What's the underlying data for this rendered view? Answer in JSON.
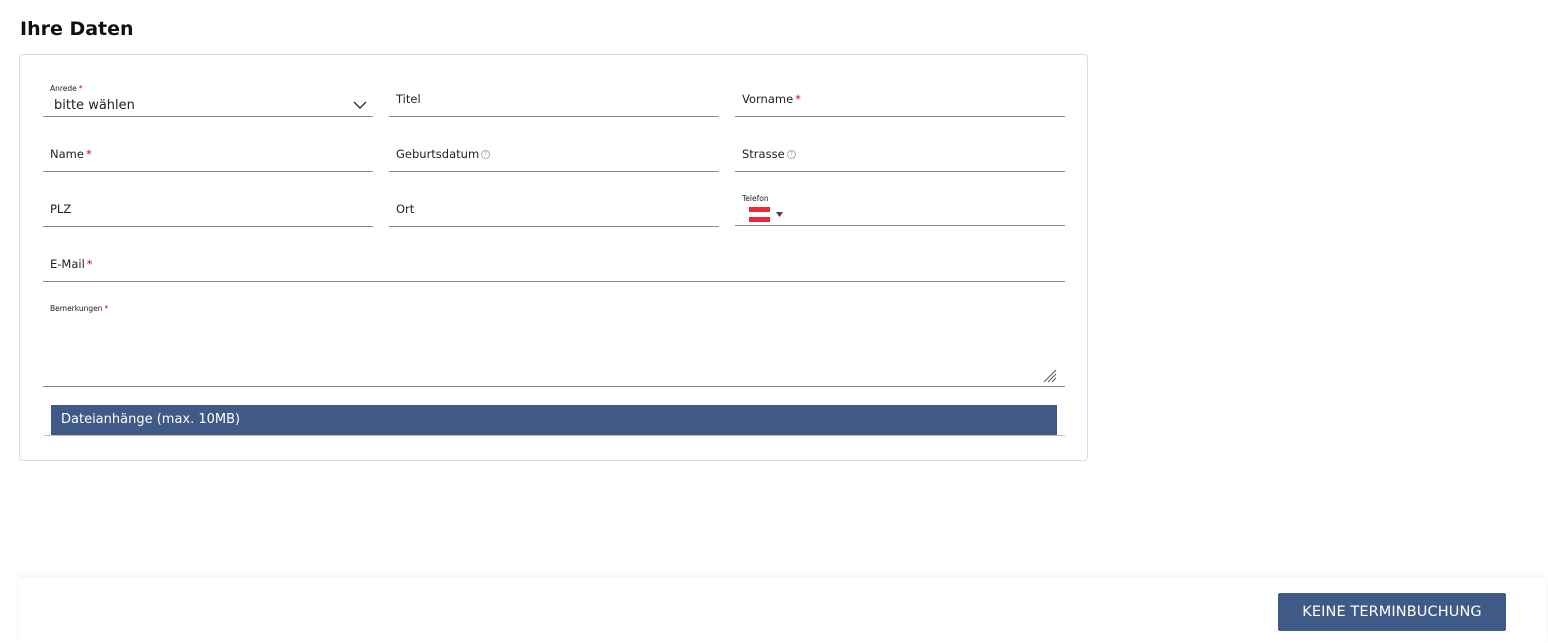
{
  "section_title": "Ihre Daten",
  "form": {
    "anrede": {
      "label": "Anrede",
      "required": "*",
      "value": "bitte wählen"
    },
    "titel": {
      "label": "Titel"
    },
    "vorname": {
      "label": "Vorname",
      "required": "*"
    },
    "name": {
      "label": "Name",
      "required": "*"
    },
    "geburtsdatum": {
      "label": "Geburtsdatum",
      "help_icon": "question-circle-icon"
    },
    "strasse": {
      "label": "Strasse",
      "help_icon": "question-circle-icon"
    },
    "plz": {
      "label": "PLZ"
    },
    "ort": {
      "label": "Ort"
    },
    "telefon": {
      "label": "Telefon",
      "country_flag": "austria-flag"
    },
    "email": {
      "label": "E-Mail",
      "required": "*"
    },
    "bemerkungen": {
      "label": "Bemerkungen",
      "required": "*"
    },
    "attachments": {
      "label": "Dateianhänge (max. 10MB)"
    }
  },
  "footer": {
    "button_label": "KEINE TERMINBUCHUNG"
  },
  "colors": {
    "accent": "#3f5a87",
    "required": "#d0021b",
    "flag_red": "#ed2939"
  }
}
